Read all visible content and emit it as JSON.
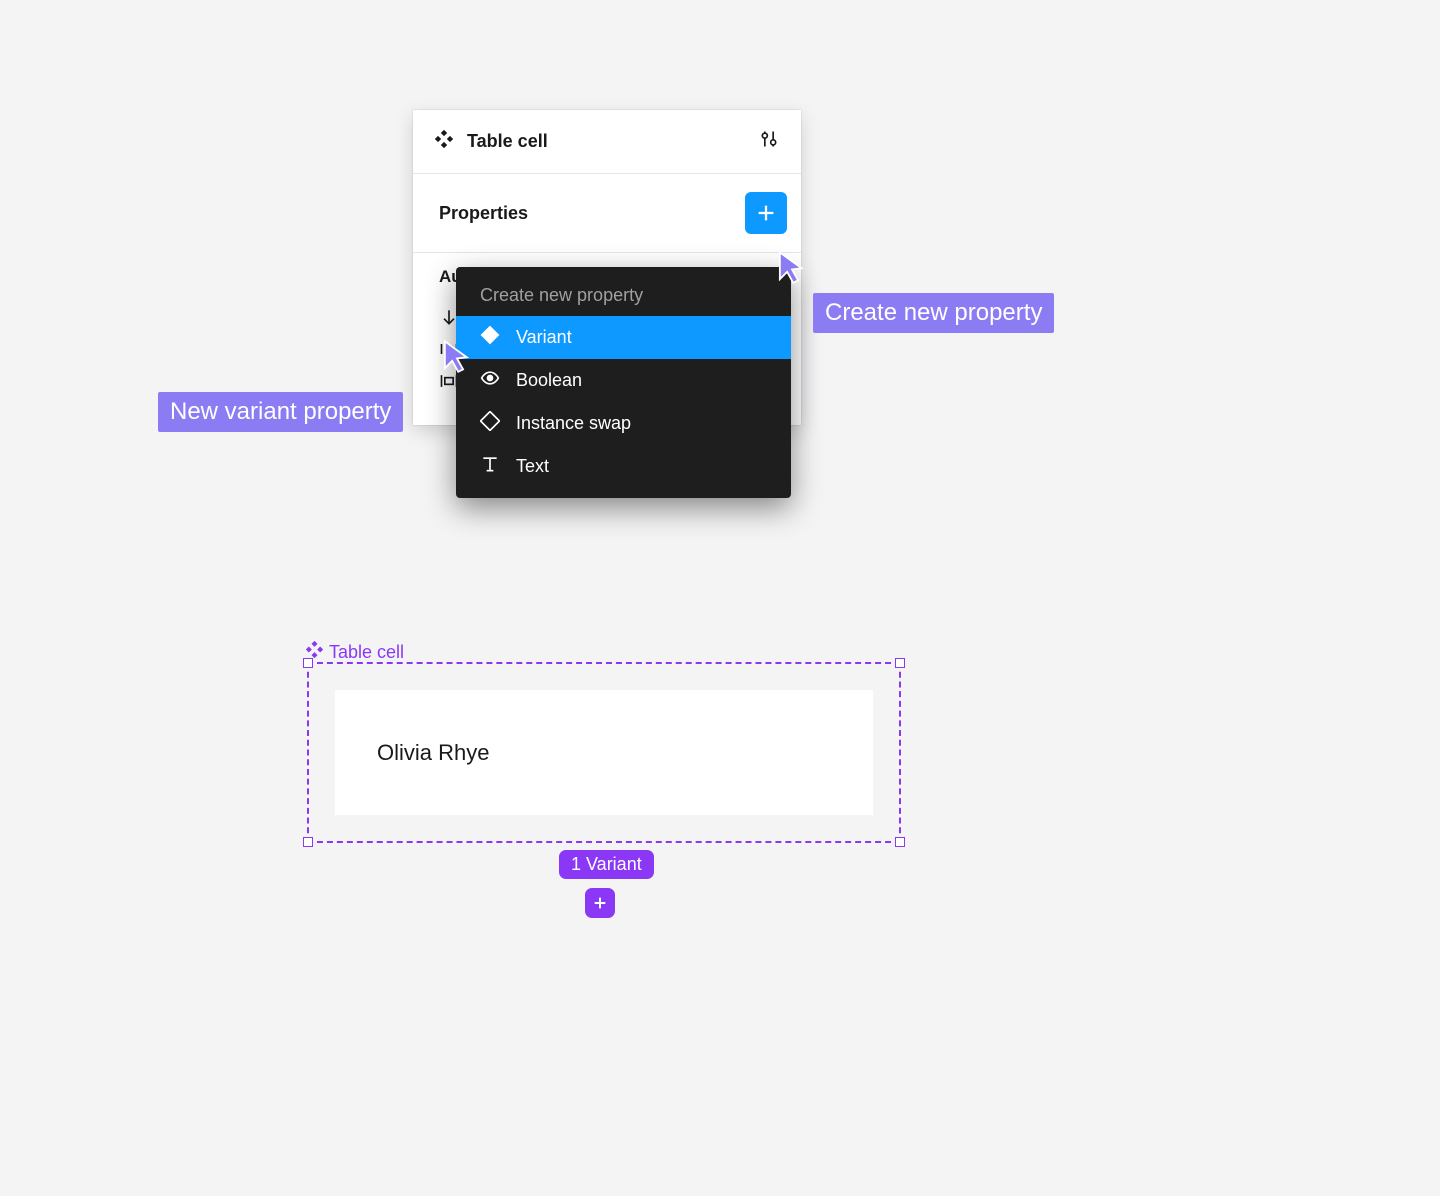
{
  "panel": {
    "title": "Table cell",
    "properties_label": "Properties",
    "auto_layout_label": "Au"
  },
  "menu": {
    "header": "Create new property",
    "items": [
      {
        "label": "Variant"
      },
      {
        "label": "Boolean"
      },
      {
        "label": "Instance swap"
      },
      {
        "label": "Text"
      }
    ]
  },
  "annotations": {
    "left": "New variant property",
    "right": "Create new property"
  },
  "canvas": {
    "frame_label": "Table cell",
    "cell_value": "Olivia Rhye",
    "variant_badge": "1 Variant"
  },
  "colors": {
    "accent_blue": "#0d99ff",
    "accent_purple": "#8a38f5",
    "annotation": "#8b7cf3"
  }
}
